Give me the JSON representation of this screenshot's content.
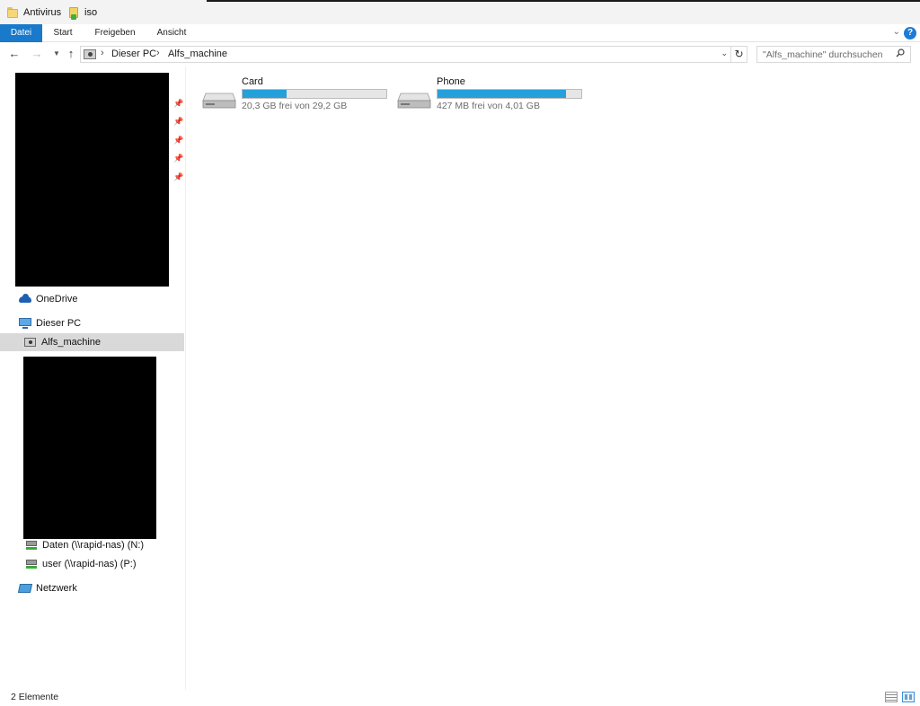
{
  "quick_access_bar": {
    "items": [
      {
        "label": "Antivirus",
        "icon": "folder-icon"
      },
      {
        "label": "iso",
        "icon": "zip-folder-icon"
      }
    ]
  },
  "ribbon": {
    "tabs": [
      {
        "label": "Datei",
        "active": true
      },
      {
        "label": "Start"
      },
      {
        "label": "Freigeben"
      },
      {
        "label": "Ansicht"
      }
    ],
    "help_label": "?"
  },
  "address_bar": {
    "crumbs": [
      "Dieser PC",
      "Alfs_machine"
    ],
    "search_placeholder": "\"Alfs_machine\" durchsuchen"
  },
  "nav_pane": {
    "onedrive": "OneDrive",
    "this_pc": "Dieser PC",
    "selected": "Alfs_machine",
    "net_drives": [
      {
        "label": "Daten (\\\\rapid-nas) (N:)"
      },
      {
        "label": "user (\\\\rapid-nas) (P:)"
      }
    ],
    "network": "Netzwerk"
  },
  "drives": [
    {
      "name": "Card",
      "free_text": "20,3 GB frei von 29,2 GB",
      "used_fraction": 0.305
    },
    {
      "name": "Phone",
      "free_text": "427 MB frei von 4,01 GB",
      "used_fraction": 0.896
    }
  ],
  "status_bar": {
    "item_count": "2 Elemente"
  },
  "colors": {
    "accent": "#1979ca",
    "usage_bar": "#26a0da",
    "redaction": "#000000"
  }
}
